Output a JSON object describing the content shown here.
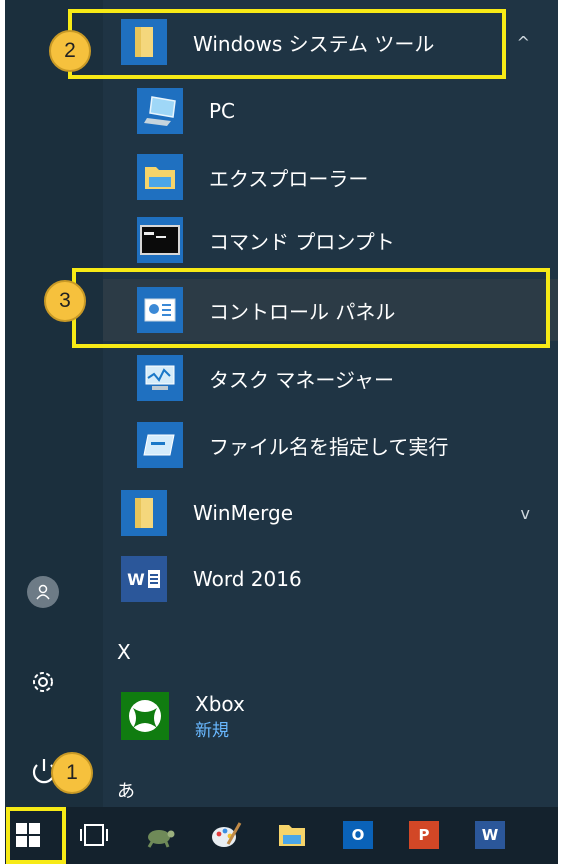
{
  "start_menu": {
    "groups": {
      "windows_system": {
        "label": "Windows システム ツール",
        "chevron": "^"
      },
      "winmerge": {
        "label": "WinMerge",
        "chevron": "v"
      }
    },
    "items": [
      {
        "label": "PC",
        "icon": "pc-icon"
      },
      {
        "label": "エクスプローラー",
        "icon": "folder-icon"
      },
      {
        "label": "コマンド プロンプト",
        "icon": "command-prompt-icon"
      },
      {
        "label": "コントロール パネル",
        "icon": "control-panel-icon"
      },
      {
        "label": "タスク マネージャー",
        "icon": "task-manager-icon"
      },
      {
        "label": "ファイル名を指定して実行",
        "icon": "run-icon"
      }
    ],
    "word": {
      "label": "Word 2016",
      "icon_text": "W"
    },
    "letter_x": "X",
    "xbox": {
      "label": "Xbox",
      "sublabel": "新規"
    },
    "letter_a": "あ"
  },
  "badges": [
    "1",
    "2",
    "3"
  ],
  "taskbar": {
    "outlook_text": "O",
    "powerpoint_text": "P",
    "word_text": "W"
  },
  "colors": {
    "menu_bg": "#1f3444",
    "accent_tile": "#0c6ec4",
    "highlight": "#f7ea16",
    "badge": "#f6c13d"
  }
}
